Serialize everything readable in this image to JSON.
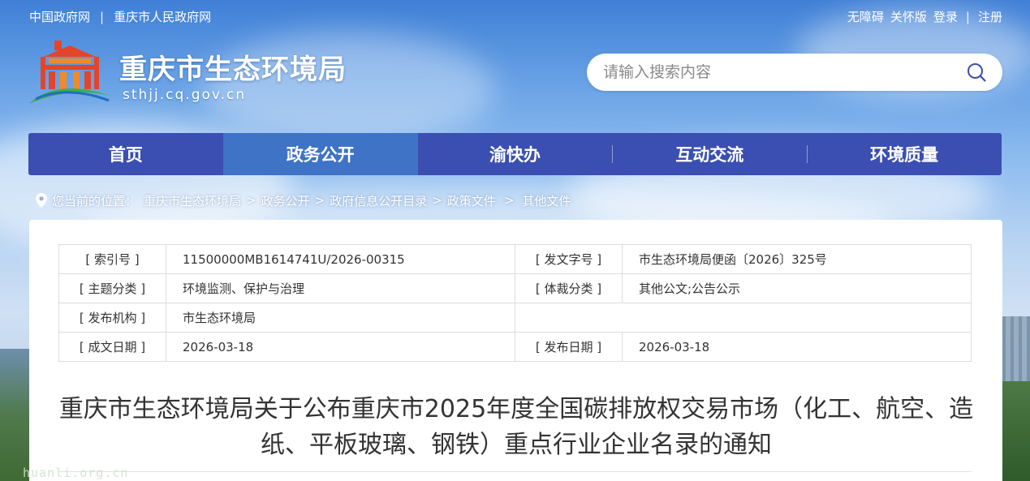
{
  "topbar": {
    "links_left": [
      "中国政府网",
      "重庆市人民政府网"
    ],
    "separator": "|",
    "accessibility": "无障碍",
    "care_mode": "关怀版",
    "login": "登录",
    "register": "注册"
  },
  "header": {
    "site_title": "重庆市生态环境局",
    "site_domain": "sthjj.cq.gov.cn"
  },
  "search": {
    "placeholder": "请输入搜索内容",
    "icon": "search-icon"
  },
  "nav": {
    "items": [
      {
        "label": "首页",
        "active": false
      },
      {
        "label": "政务公开",
        "active": true
      },
      {
        "label": "渝快办",
        "active": false
      },
      {
        "label": "互动交流",
        "active": false
      },
      {
        "label": "环境质量",
        "active": false
      }
    ]
  },
  "breadcrumb": {
    "prefix": "您当前的位置：",
    "items": [
      "重庆市生态环境局",
      "政务公开",
      "政府信息公开目录",
      "政策文件",
      "其他文件"
    ],
    "separator": ">"
  },
  "meta": {
    "rows": [
      [
        {
          "k": "[ 索引号 ]",
          "v": "11500000MB1614741U/2026-00315"
        },
        {
          "k": "[ 发文字号 ]",
          "v": "市生态环境局便函〔2026〕325号"
        }
      ],
      [
        {
          "k": "[ 主题分类 ]",
          "v": "环境监测、保护与治理"
        },
        {
          "k": "[ 体裁分类 ]",
          "v": "其他公文;公告公示"
        }
      ],
      [
        {
          "k": "[ 发布机构 ]",
          "v": "市生态环境局"
        },
        {
          "k": "",
          "v": ""
        }
      ],
      [
        {
          "k": "[ 成文日期 ]",
          "v": "2026-03-18"
        },
        {
          "k": "[ 发布日期 ]",
          "v": "2026-03-18"
        }
      ]
    ]
  },
  "document": {
    "title_line1": "重庆市生态环境局关于公布重庆市2025年度全国碳排放权交易市场（化工、航空、造",
    "title_line2": "纸、平板玻璃、钢铁）重点行业企业名录的通知"
  },
  "watermark": "huanli.org.cn",
  "colors": {
    "nav_bg": "#3a4fb1",
    "nav_active": "#3e73c6",
    "text": "#333333"
  }
}
